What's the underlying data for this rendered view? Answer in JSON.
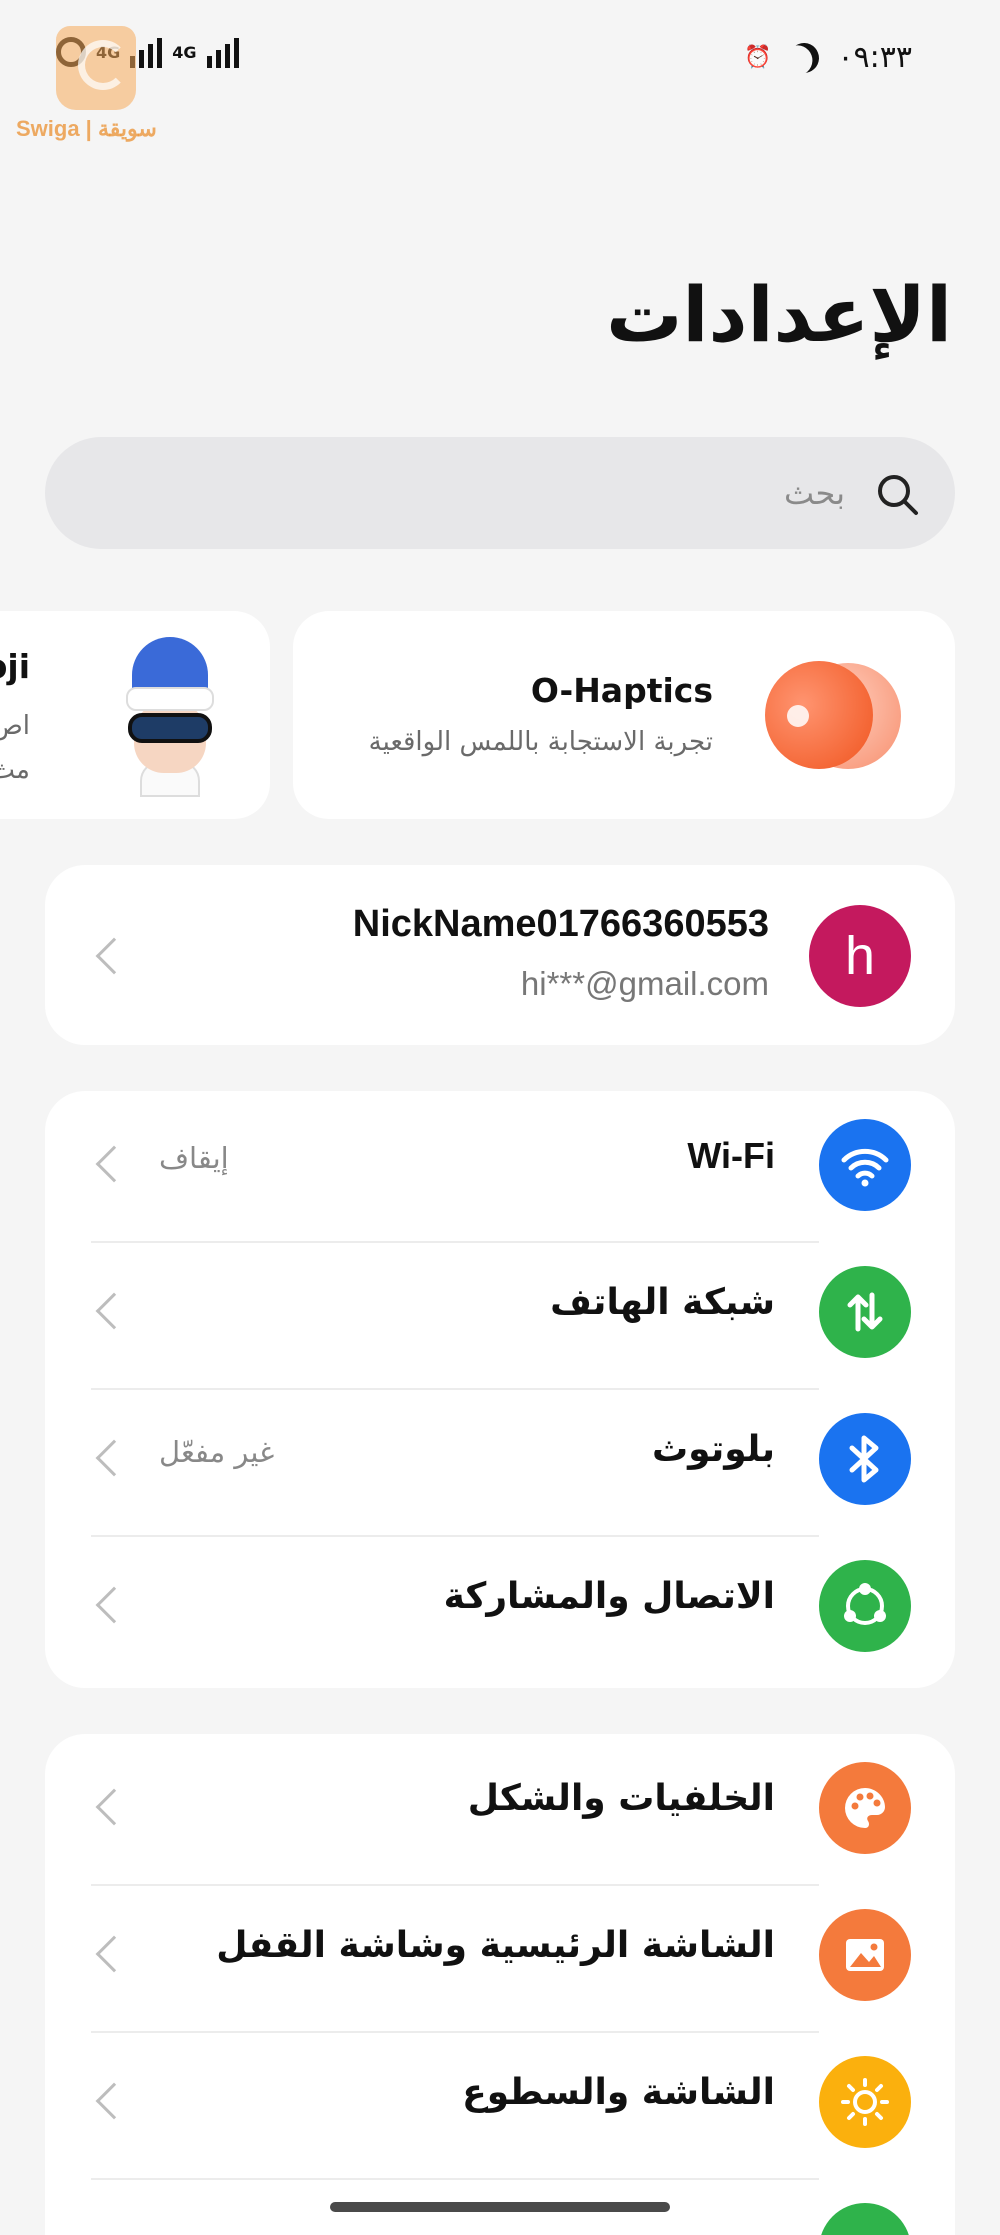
{
  "status_bar": {
    "time": "٠٩:٣٣",
    "network_1": "4G",
    "network_2": "4G"
  },
  "watermark": {
    "text": "Swiga | سويقة"
  },
  "page": {
    "title": "الإعدادات"
  },
  "search": {
    "placeholder": "بحث",
    "value": ""
  },
  "feature_cards": {
    "haptics": {
      "title": "O-Haptics",
      "subtitle": "تجربة الاستجابة باللمس الواقعية"
    },
    "omoji": {
      "title": "Omoji",
      "line1": "اص",
      "line2": "مث"
    }
  },
  "account": {
    "avatar_letter": "h",
    "avatar_color": "#c4195e",
    "name": "NickName01766360553",
    "email": "hi***@gmail.com"
  },
  "connectivity": {
    "items": [
      {
        "label": "Wi-Fi",
        "value": "إيقاف",
        "icon": "wifi-icon",
        "color": "#1a73f0"
      },
      {
        "label": "شبكة الهاتف",
        "value": "",
        "icon": "mobile-data-icon",
        "color": "#2fb34b"
      },
      {
        "label": "بلوتوث",
        "value": "غير مفعّل",
        "icon": "bluetooth-icon",
        "color": "#1a73f0"
      },
      {
        "label": "الاتصال والمشاركة",
        "value": "",
        "icon": "share-icon",
        "color": "#2fb34b"
      }
    ]
  },
  "display": {
    "items": [
      {
        "label": "الخلفيات والشكل",
        "icon": "palette-icon",
        "color": "#f47a3c"
      },
      {
        "label": "الشاشة الرئيسية وشاشة القفل",
        "icon": "image-icon",
        "color": "#f47a3c"
      },
      {
        "label": "الشاشة والسطوع",
        "icon": "brightness-icon",
        "color": "#fbb00d"
      },
      {
        "label": "",
        "icon": "partial-icon",
        "color": "#2fb34b"
      }
    ]
  }
}
